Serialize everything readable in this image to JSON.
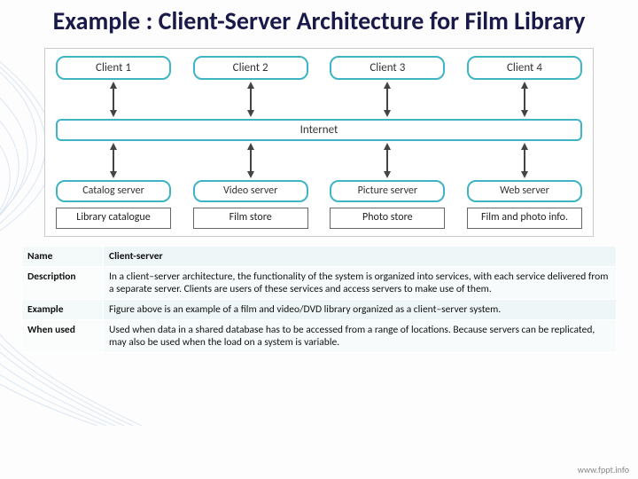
{
  "title": "Example : Client-Server Architecture for Film Library",
  "clients": [
    "Client 1",
    "Client 2",
    "Client 3",
    "Client 4"
  ],
  "middle": "Internet",
  "servers": [
    "Catalog server",
    "Video server",
    "Picture server",
    "Web server"
  ],
  "stores": [
    "Library catalogue",
    "Film store",
    "Photo store",
    "Film and photo info."
  ],
  "table": {
    "rows": [
      {
        "label": "Name",
        "text": "Client-server"
      },
      {
        "label": "Description",
        "text": "In a client–server architecture, the functionality of the system is organized into services, with each service delivered from a separate server. Clients are users of these services and access servers to make use of them."
      },
      {
        "label": "Example",
        "text": "Figure above is an example of a film and video/DVD library organized as a client–server system."
      },
      {
        "label": "When used",
        "text": "Used when data in a shared database has to be accessed from a range of locations. Because servers can be replicated, may also be used when the load on a system is variable."
      }
    ]
  },
  "footer": "www.fppt.info",
  "colors": {
    "boxBorder": "#3fb4c4",
    "titleColor": "#1a1a4a"
  }
}
